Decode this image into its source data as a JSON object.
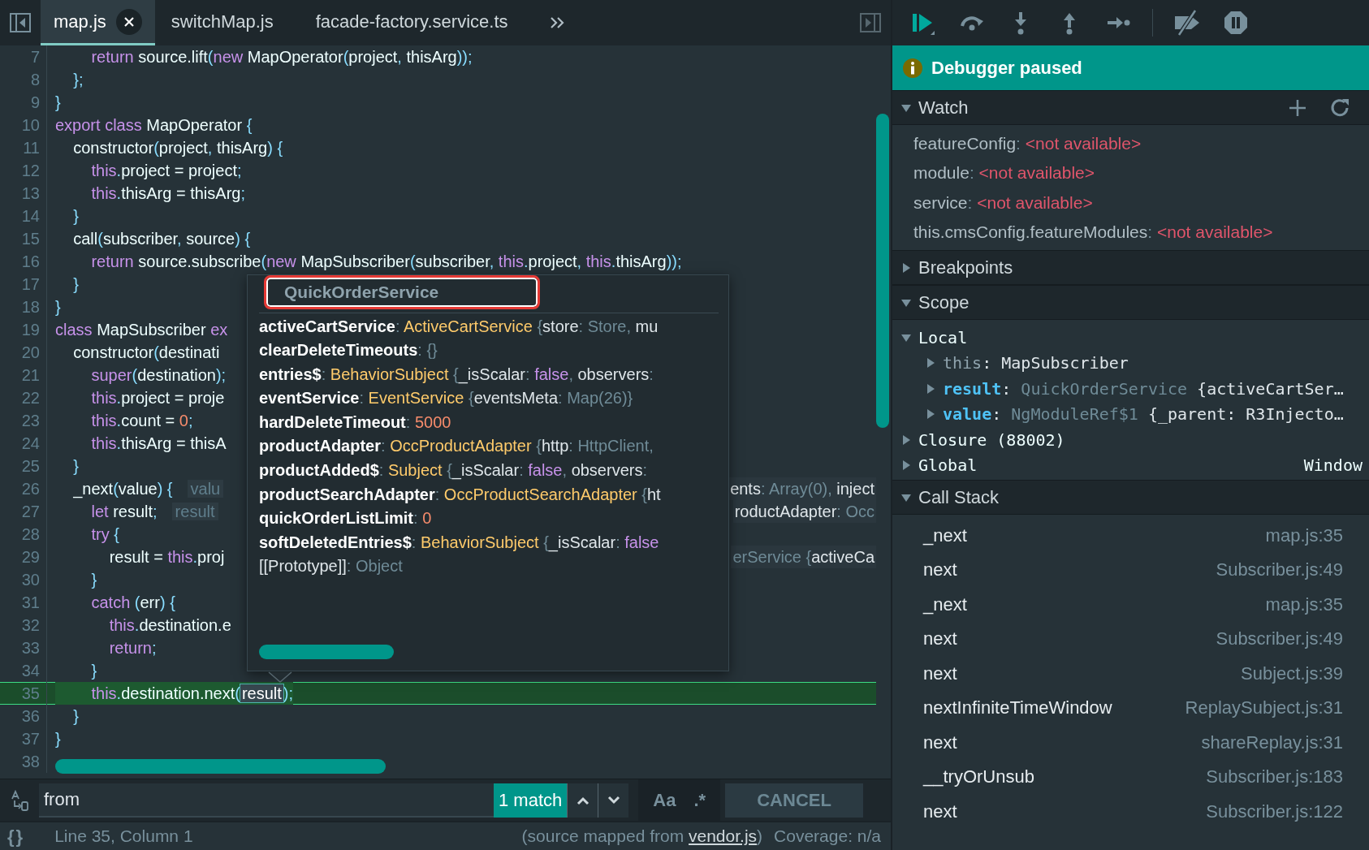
{
  "tabs": [
    {
      "label": "map.js",
      "selected": true,
      "closable": true
    },
    {
      "label": "switchMap.js",
      "selected": false,
      "closable": false
    },
    {
      "label": "facade-factory.service.ts",
      "selected": false,
      "closable": false
    }
  ],
  "code_lines": [
    {
      "number": "7",
      "current": false,
      "segs": [
        {
          "kind": "keyword",
          "text": "        return "
        },
        {
          "kind": "ident",
          "text": "source.lift"
        },
        {
          "kind": "punct",
          "text": "("
        },
        {
          "kind": "keyword",
          "text": "new "
        },
        {
          "kind": "ident",
          "text": "MapOperator"
        },
        {
          "kind": "punct",
          "text": "("
        },
        {
          "kind": "ident",
          "text": "project"
        },
        {
          "kind": "punct",
          "text": ", "
        },
        {
          "kind": "ident",
          "text": "thisArg"
        },
        {
          "kind": "punct",
          "text": "));"
        }
      ]
    },
    {
      "number": "8",
      "current": false,
      "segs": [
        {
          "kind": "punct",
          "text": "    };"
        }
      ]
    },
    {
      "number": "9",
      "current": false,
      "segs": [
        {
          "kind": "punct",
          "text": "}"
        }
      ]
    },
    {
      "number": "10",
      "current": false,
      "segs": [
        {
          "kind": "keyword",
          "text": "export class "
        },
        {
          "kind": "ident",
          "text": "MapOperator "
        },
        {
          "kind": "punct",
          "text": "{"
        }
      ]
    },
    {
      "number": "11",
      "current": false,
      "segs": [
        {
          "kind": "ident",
          "text": "    constructor"
        },
        {
          "kind": "punct",
          "text": "("
        },
        {
          "kind": "ident",
          "text": "project"
        },
        {
          "kind": "punct",
          "text": ", "
        },
        {
          "kind": "ident",
          "text": "thisArg"
        },
        {
          "kind": "punct",
          "text": ") {"
        }
      ]
    },
    {
      "number": "12",
      "current": false,
      "segs": [
        {
          "kind": "keyword",
          "text": "        this"
        },
        {
          "kind": "punct",
          "text": "."
        },
        {
          "kind": "ident",
          "text": "project = project"
        },
        {
          "kind": "punct",
          "text": ";"
        }
      ]
    },
    {
      "number": "13",
      "current": false,
      "segs": [
        {
          "kind": "keyword",
          "text": "        this"
        },
        {
          "kind": "punct",
          "text": "."
        },
        {
          "kind": "ident",
          "text": "thisArg = thisArg"
        },
        {
          "kind": "punct",
          "text": ";"
        }
      ]
    },
    {
      "number": "14",
      "current": false,
      "segs": [
        {
          "kind": "punct",
          "text": "    }"
        }
      ]
    },
    {
      "number": "15",
      "current": false,
      "segs": [
        {
          "kind": "ident",
          "text": "    call"
        },
        {
          "kind": "punct",
          "text": "("
        },
        {
          "kind": "ident",
          "text": "subscriber"
        },
        {
          "kind": "punct",
          "text": ", "
        },
        {
          "kind": "ident",
          "text": "source"
        },
        {
          "kind": "punct",
          "text": ") {"
        }
      ]
    },
    {
      "number": "16",
      "current": false,
      "segs": [
        {
          "kind": "keyword",
          "text": "        return "
        },
        {
          "kind": "ident",
          "text": "source.subscribe"
        },
        {
          "kind": "punct",
          "text": "("
        },
        {
          "kind": "keyword",
          "text": "new "
        },
        {
          "kind": "ident",
          "text": "MapSubscriber"
        },
        {
          "kind": "punct",
          "text": "("
        },
        {
          "kind": "ident",
          "text": "subscriber"
        },
        {
          "kind": "punct",
          "text": ", "
        },
        {
          "kind": "keyword",
          "text": "this"
        },
        {
          "kind": "punct",
          "text": "."
        },
        {
          "kind": "ident",
          "text": "project"
        },
        {
          "kind": "punct",
          "text": ", "
        },
        {
          "kind": "keyword",
          "text": "this"
        },
        {
          "kind": "punct",
          "text": "."
        },
        {
          "kind": "ident",
          "text": "thisArg"
        },
        {
          "kind": "punct",
          "text": "));"
        }
      ]
    },
    {
      "number": "17",
      "current": false,
      "segs": [
        {
          "kind": "punct",
          "text": "    }"
        }
      ]
    },
    {
      "number": "18",
      "current": false,
      "segs": [
        {
          "kind": "punct",
          "text": "}"
        }
      ]
    },
    {
      "number": "19",
      "current": false,
      "segs": [
        {
          "kind": "keyword",
          "text": "class "
        },
        {
          "kind": "ident",
          "text": "MapSubscriber "
        },
        {
          "kind": "keyword",
          "text": "ex"
        }
      ]
    },
    {
      "number": "20",
      "current": false,
      "segs": [
        {
          "kind": "ident",
          "text": "    constructor"
        },
        {
          "kind": "punct",
          "text": "("
        },
        {
          "kind": "ident",
          "text": "destinati"
        }
      ]
    },
    {
      "number": "21",
      "current": false,
      "segs": [
        {
          "kind": "keyword",
          "text": "        super"
        },
        {
          "kind": "punct",
          "text": "("
        },
        {
          "kind": "ident",
          "text": "destination"
        },
        {
          "kind": "punct",
          "text": ");"
        }
      ]
    },
    {
      "number": "22",
      "current": false,
      "segs": [
        {
          "kind": "keyword",
          "text": "        this"
        },
        {
          "kind": "punct",
          "text": "."
        },
        {
          "kind": "ident",
          "text": "project = proje"
        }
      ]
    },
    {
      "number": "23",
      "current": false,
      "segs": [
        {
          "kind": "keyword",
          "text": "        this"
        },
        {
          "kind": "punct",
          "text": "."
        },
        {
          "kind": "ident",
          "text": "count = "
        },
        {
          "kind": "number",
          "text": "0"
        },
        {
          "kind": "punct",
          "text": ";"
        }
      ]
    },
    {
      "number": "24",
      "current": false,
      "segs": [
        {
          "kind": "keyword",
          "text": "        this"
        },
        {
          "kind": "punct",
          "text": "."
        },
        {
          "kind": "ident",
          "text": "thisArg = thisA"
        }
      ]
    },
    {
      "number": "25",
      "current": false,
      "segs": [
        {
          "kind": "punct",
          "text": "    }"
        }
      ]
    },
    {
      "number": "26",
      "current": false,
      "segs": [
        {
          "kind": "ident",
          "text": "    _next"
        },
        {
          "kind": "punct",
          "text": "("
        },
        {
          "kind": "ident",
          "text": "value"
        },
        {
          "kind": "punct",
          "text": ") {"
        },
        {
          "kind": "hint",
          "text": "valu"
        }
      ],
      "right_hint": [
        {
          "kind": "value",
          "text": "ents"
        },
        {
          "kind": "muted",
          "text": ": Array(0), "
        },
        {
          "kind": "value",
          "text": "inject"
        }
      ]
    },
    {
      "number": "27",
      "current": false,
      "segs": [
        {
          "kind": "keyword",
          "text": "        let "
        },
        {
          "kind": "ident",
          "text": "result"
        },
        {
          "kind": "punct",
          "text": ";"
        },
        {
          "kind": "hint",
          "text": "result"
        }
      ],
      "right_hint": [
        {
          "kind": "value",
          "text": "roductAdapter"
        },
        {
          "kind": "muted",
          "text": ": Occ"
        }
      ]
    },
    {
      "number": "28",
      "current": false,
      "segs": [
        {
          "kind": "keyword",
          "text": "        try "
        },
        {
          "kind": "punct",
          "text": "{"
        }
      ]
    },
    {
      "number": "29",
      "current": false,
      "segs": [
        {
          "kind": "ident",
          "text": "            result = "
        },
        {
          "kind": "keyword",
          "text": "this"
        },
        {
          "kind": "punct",
          "text": "."
        },
        {
          "kind": "ident",
          "text": "proj"
        }
      ],
      "right_hint": [
        {
          "kind": "muted",
          "text": "erService {"
        },
        {
          "kind": "value",
          "text": "activeCa"
        }
      ]
    },
    {
      "number": "30",
      "current": false,
      "segs": [
        {
          "kind": "punct",
          "text": "        }"
        }
      ]
    },
    {
      "number": "31",
      "current": false,
      "segs": [
        {
          "kind": "keyword",
          "text": "        catch "
        },
        {
          "kind": "punct",
          "text": "("
        },
        {
          "kind": "ident",
          "text": "err"
        },
        {
          "kind": "punct",
          "text": ") {"
        }
      ]
    },
    {
      "number": "32",
      "current": false,
      "segs": [
        {
          "kind": "keyword",
          "text": "            this"
        },
        {
          "kind": "punct",
          "text": "."
        },
        {
          "kind": "ident",
          "text": "destination.e"
        }
      ]
    },
    {
      "number": "33",
      "current": false,
      "segs": [
        {
          "kind": "keyword",
          "text": "            return"
        },
        {
          "kind": "punct",
          "text": ";"
        }
      ]
    },
    {
      "number": "34",
      "current": false,
      "segs": [
        {
          "kind": "punct",
          "text": "        }"
        }
      ]
    },
    {
      "number": "35",
      "current": true,
      "segs": [
        {
          "kind": "keyword",
          "text": "        this"
        },
        {
          "kind": "punct",
          "text": "."
        },
        {
          "kind": "ident",
          "text": "destination.next"
        },
        {
          "kind": "punct",
          "text": "("
        },
        {
          "kind": "match",
          "text": "result"
        },
        {
          "kind": "punct",
          "text": ");"
        }
      ]
    },
    {
      "number": "36",
      "current": false,
      "segs": [
        {
          "kind": "punct",
          "text": "    }"
        }
      ]
    },
    {
      "number": "37",
      "current": false,
      "segs": [
        {
          "kind": "punct",
          "text": "}"
        }
      ]
    },
    {
      "number": "38",
      "current": false
    }
  ],
  "popup": {
    "title": "QuickOrderService",
    "properties": [
      {
        "name": "activeCartService",
        "kind": "own",
        "segs": [
          {
            "kind": "muted",
            "text": ": "
          },
          {
            "kind": "type",
            "text": "ActiveCartService "
          },
          {
            "kind": "muted",
            "text": "{"
          },
          {
            "kind": "value",
            "text": "store"
          },
          {
            "kind": "muted",
            "text": ": Store, "
          },
          {
            "kind": "value",
            "text": "mu"
          }
        ]
      },
      {
        "name": "clearDeleteTimeouts",
        "kind": "own",
        "segs": [
          {
            "kind": "muted",
            "text": ": "
          },
          {
            "kind": "muted",
            "text": "{}"
          }
        ]
      },
      {
        "name": "entries$",
        "kind": "own",
        "segs": [
          {
            "kind": "muted",
            "text": ": "
          },
          {
            "kind": "type",
            "text": "BehaviorSubject "
          },
          {
            "kind": "muted",
            "text": "{"
          },
          {
            "kind": "value",
            "text": "_isScalar"
          },
          {
            "kind": "muted",
            "text": ": "
          },
          {
            "kind": "keyword",
            "text": "false"
          },
          {
            "kind": "muted",
            "text": ", "
          },
          {
            "kind": "value",
            "text": "observers"
          },
          {
            "kind": "muted",
            "text": ":"
          }
        ]
      },
      {
        "name": "eventService",
        "kind": "own",
        "segs": [
          {
            "kind": "muted",
            "text": ": "
          },
          {
            "kind": "type",
            "text": "EventService "
          },
          {
            "kind": "muted",
            "text": "{"
          },
          {
            "kind": "value",
            "text": "eventsMeta"
          },
          {
            "kind": "muted",
            "text": ": Map(26)}"
          }
        ]
      },
      {
        "name": "hardDeleteTimeout",
        "kind": "own",
        "segs": [
          {
            "kind": "muted",
            "text": ": "
          },
          {
            "kind": "number",
            "text": "5000"
          }
        ]
      },
      {
        "name": "productAdapter",
        "kind": "own",
        "segs": [
          {
            "kind": "muted",
            "text": ": "
          },
          {
            "kind": "type",
            "text": "OccProductAdapter "
          },
          {
            "kind": "muted",
            "text": "{"
          },
          {
            "kind": "value",
            "text": "http"
          },
          {
            "kind": "muted",
            "text": ": HttpClient,"
          }
        ]
      },
      {
        "name": "productAdded$",
        "kind": "own",
        "segs": [
          {
            "kind": "muted",
            "text": ": "
          },
          {
            "kind": "type",
            "text": "Subject "
          },
          {
            "kind": "muted",
            "text": "{"
          },
          {
            "kind": "value",
            "text": "_isScalar"
          },
          {
            "kind": "muted",
            "text": ": "
          },
          {
            "kind": "keyword",
            "text": "false"
          },
          {
            "kind": "muted",
            "text": ", "
          },
          {
            "kind": "value",
            "text": "observers"
          },
          {
            "kind": "muted",
            "text": ":"
          }
        ]
      },
      {
        "name": "productSearchAdapter",
        "kind": "own",
        "segs": [
          {
            "kind": "muted",
            "text": ": "
          },
          {
            "kind": "type",
            "text": "OccProductSearchAdapter "
          },
          {
            "kind": "muted",
            "text": "{"
          },
          {
            "kind": "value",
            "text": "ht"
          }
        ]
      },
      {
        "name": "quickOrderListLimit",
        "kind": "own",
        "segs": [
          {
            "kind": "muted",
            "text": ": "
          },
          {
            "kind": "number",
            "text": "0"
          }
        ]
      },
      {
        "name": "softDeletedEntries$",
        "kind": "own",
        "segs": [
          {
            "kind": "muted",
            "text": ": "
          },
          {
            "kind": "type",
            "text": "BehaviorSubject "
          },
          {
            "kind": "muted",
            "text": "{"
          },
          {
            "kind": "value",
            "text": "_isScalar"
          },
          {
            "kind": "muted",
            "text": ": "
          },
          {
            "kind": "keyword",
            "text": "false"
          }
        ]
      },
      {
        "name": "[[Prototype]]",
        "kind": "internal",
        "segs": [
          {
            "kind": "muted",
            "text": ": "
          },
          {
            "kind": "muted",
            "text": "Object"
          }
        ]
      }
    ]
  },
  "find": {
    "query": "from",
    "match_count": "1 match",
    "case_label": "Aa",
    "regex_label": ".*",
    "cancel_label": "CANCEL"
  },
  "status": {
    "pretty_print": "{}",
    "position": "Line 35, Column 1",
    "source_prefix": "(source mapped from ",
    "source_link": "vendor.js",
    "source_suffix": ")",
    "coverage": "Coverage: n/a"
  },
  "paused_message": "Debugger paused",
  "watch": {
    "title": "Watch",
    "expanded": true,
    "items": [
      {
        "name": "featureConfig",
        "value": [
          {
            "kind": "muted",
            "text": ": "
          },
          {
            "kind": "error",
            "text": "<not available>"
          }
        ]
      },
      {
        "name": "module",
        "value": [
          {
            "kind": "muted",
            "text": ": "
          },
          {
            "kind": "error",
            "text": "<not available>"
          }
        ]
      },
      {
        "name": "service",
        "value": [
          {
            "kind": "muted",
            "text": ": "
          },
          {
            "kind": "error",
            "text": "<not available>"
          }
        ]
      },
      {
        "name": "this.cmsConfig.featureModules",
        "value": [
          {
            "kind": "muted",
            "text": ": "
          },
          {
            "kind": "error",
            "text": "<not available>"
          }
        ]
      }
    ]
  },
  "breakpoints": {
    "title": "Breakpoints",
    "expanded": false
  },
  "scope": {
    "title": "Scope",
    "expanded": true,
    "items": [
      {
        "name": "Local",
        "expanded": true,
        "children": [
          {
            "name": "this",
            "kind": "muted",
            "expanded": false,
            "value": [
              {
                "kind": "value",
                "text": ": MapSubscriber"
              }
            ]
          },
          {
            "name": "result",
            "kind": "accent",
            "expanded": false,
            "value": [
              {
                "kind": "value",
                "text": ": "
              },
              {
                "kind": "muted",
                "text": "QuickOrderService "
              },
              {
                "kind": "value",
                "text": "{activeCartSer…"
              }
            ]
          },
          {
            "name": "value",
            "kind": "accent",
            "expanded": false,
            "value": [
              {
                "kind": "value",
                "text": ": "
              },
              {
                "kind": "muted",
                "text": "NgModuleRef$1 "
              },
              {
                "kind": "value",
                "text": "{_parent: R3Injecto…"
              }
            ]
          }
        ]
      },
      {
        "name": "Closure (88002)",
        "expanded": false
      },
      {
        "name": "Global",
        "expanded": false,
        "right_value": "Window"
      }
    ]
  },
  "call_stack": {
    "title": "Call Stack",
    "expanded": true,
    "frames": [
      {
        "function": "_next",
        "location": "map.js:35"
      },
      {
        "function": "next",
        "location": "Subscriber.js:49"
      },
      {
        "function": "_next",
        "location": "map.js:35"
      },
      {
        "function": "next",
        "location": "Subscriber.js:49"
      },
      {
        "function": "next",
        "location": "Subject.js:39"
      },
      {
        "function": "nextInfiniteTimeWindow",
        "location": "ReplaySubject.js:31"
      },
      {
        "function": "next",
        "location": "shareReplay.js:31"
      },
      {
        "function": "__tryOrUnsub",
        "location": "Subscriber.js:183"
      },
      {
        "function": "next",
        "location": "Subscriber.js:122"
      }
    ]
  }
}
